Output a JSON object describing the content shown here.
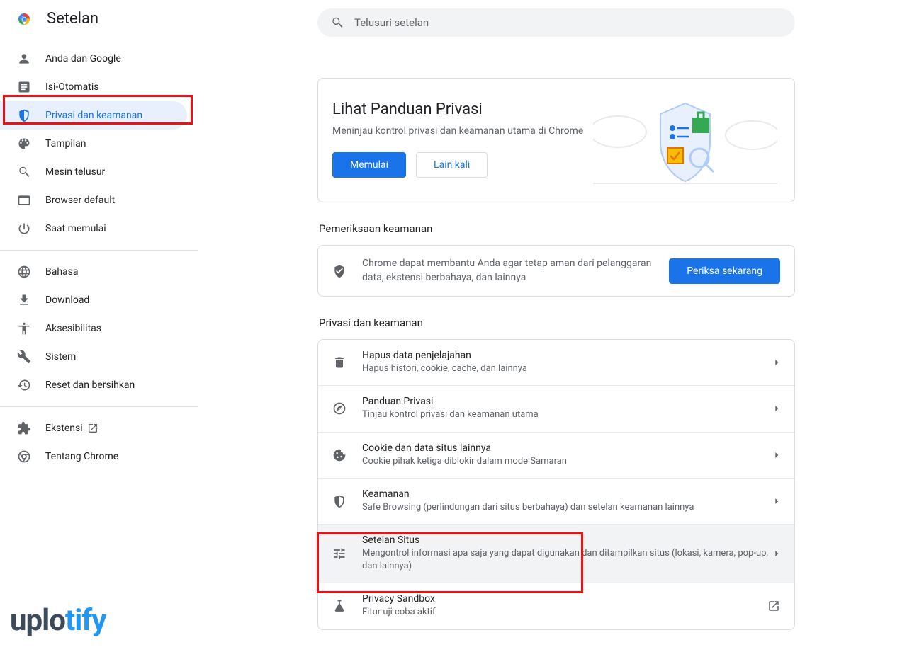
{
  "header": {
    "title": "Setelan"
  },
  "search": {
    "placeholder": "Telusuri setelan"
  },
  "sidebar": {
    "group1": [
      {
        "icon": "person",
        "label": "Anda dan Google"
      },
      {
        "icon": "autofill",
        "label": "Isi-Otomatis"
      },
      {
        "icon": "shield",
        "label": "Privasi dan keamanan",
        "active": true
      },
      {
        "icon": "palette",
        "label": "Tampilan"
      },
      {
        "icon": "search",
        "label": "Mesin telusur"
      },
      {
        "icon": "window",
        "label": "Browser default"
      },
      {
        "icon": "power",
        "label": "Saat memulai"
      }
    ],
    "group2": [
      {
        "icon": "globe",
        "label": "Bahasa"
      },
      {
        "icon": "download",
        "label": "Download"
      },
      {
        "icon": "accessibility",
        "label": "Aksesibilitas"
      },
      {
        "icon": "wrench",
        "label": "Sistem"
      },
      {
        "icon": "restore",
        "label": "Reset dan bersihkan"
      }
    ],
    "group3": [
      {
        "icon": "extension",
        "label": "Ekstensi",
        "launch": true
      },
      {
        "icon": "chrome-outline",
        "label": "Tentang Chrome"
      }
    ]
  },
  "guide": {
    "title": "Lihat Panduan Privasi",
    "subtitle": "Meninjau kontrol privasi dan keamanan utama di Chrome",
    "primary": "Memulai",
    "secondary": "Lain kali"
  },
  "safety": {
    "header": "Pemeriksaan keamanan",
    "text": "Chrome dapat membantu Anda agar tetap aman dari pelanggaran data, ekstensi berbahaya, dan lainnya",
    "button": "Periksa sekarang"
  },
  "privacy": {
    "header": "Privasi dan keamanan",
    "rows": [
      {
        "icon": "trash",
        "title": "Hapus data penjelajahan",
        "sub": "Hapus histori, cookie, cache, dan lainnya"
      },
      {
        "icon": "compass",
        "title": "Panduan Privasi",
        "sub": "Tinjau kontrol privasi dan keamanan utama"
      },
      {
        "icon": "cookie",
        "title": "Cookie dan data situs lainnya",
        "sub": "Cookie pihak ketiga diblokir dalam mode Samaran"
      },
      {
        "icon": "shield",
        "title": "Keamanan",
        "sub": "Safe Browsing (perlindungan dari situs berbahaya) dan setelan keamanan lainnya"
      },
      {
        "icon": "tune",
        "title": "Setelan Situs",
        "sub": "Mengontrol informasi apa saja yang dapat digunakan dan ditampilkan situs (lokasi, kamera, pop-up, dan lainnya)",
        "hovered": true
      },
      {
        "icon": "flask",
        "title": "Privacy Sandbox",
        "sub": "Fitur uji coba aktif",
        "launch": true
      }
    ]
  },
  "watermark": {
    "a": "uplo",
    "b": "tify"
  }
}
